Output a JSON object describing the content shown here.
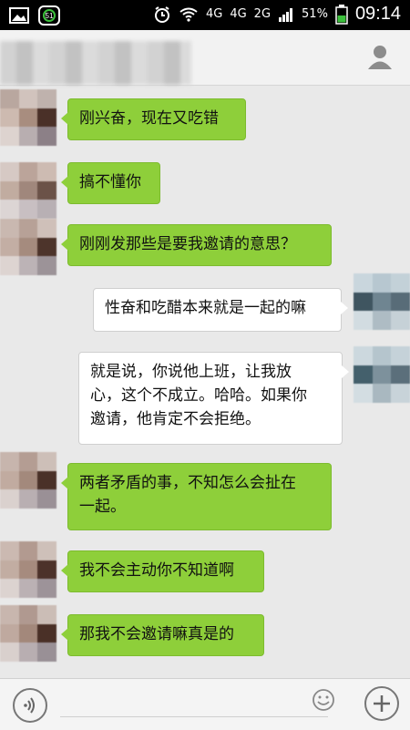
{
  "status_bar": {
    "time": "09:14",
    "battery": "51%",
    "network_labels": [
      "4G",
      "4G",
      "2G"
    ],
    "icons": [
      "gallery-icon",
      "notification-icon",
      "alarm-icon",
      "wifi-icon",
      "signal-icon",
      "battery-icon"
    ],
    "notification_badge": "51"
  },
  "chat": {
    "messages": [
      {
        "side": "left",
        "text": "刚兴奋，现在又吃错"
      },
      {
        "side": "left",
        "text": "搞不懂你"
      },
      {
        "side": "left",
        "text": "刚刚发那些是要我邀请的意思？"
      },
      {
        "side": "right",
        "text": "性奋和吃醋本来就是一起的嘛"
      },
      {
        "side": "right",
        "lines": [
          "就是说，你说他上班，让我放",
          "心，这个不成立。哈哈。如果你",
          "邀请，他肯定不会拒绝。"
        ]
      },
      {
        "side": "left",
        "lines": [
          "两者矛盾的事，不知怎么会扯在",
          "一起。"
        ]
      },
      {
        "side": "left",
        "text": "我不会主动你不知道啊"
      },
      {
        "side": "left",
        "text": "那我不会邀请嘛真是的"
      }
    ]
  },
  "colors": {
    "sent_bubble": "#8ecf3a",
    "received_bubble": "#ffffff",
    "background": "#e9e9e9"
  }
}
